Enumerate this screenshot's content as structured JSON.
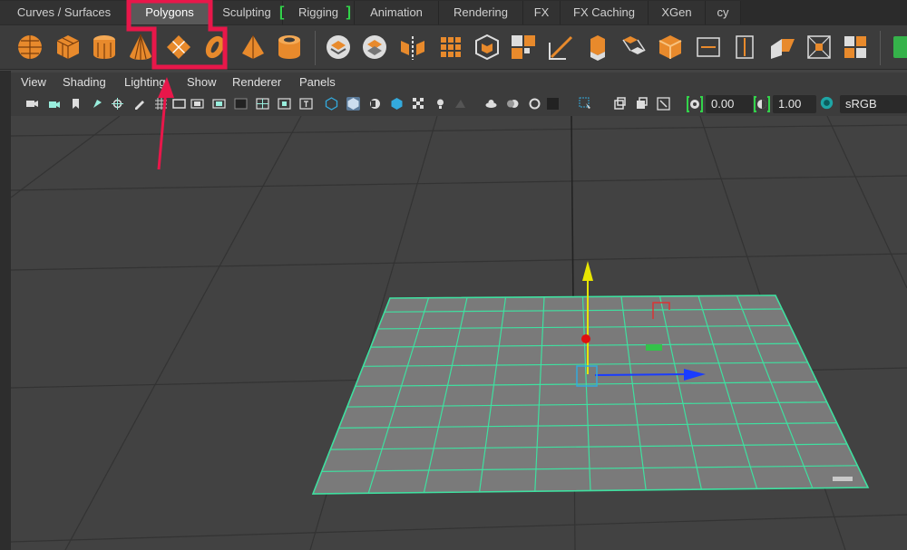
{
  "shelf_tabs": [
    {
      "label": "Curves / Surfaces"
    },
    {
      "label": "Polygons",
      "active": true
    },
    {
      "label": "Sculpting"
    },
    {
      "label": "Rigging"
    },
    {
      "label": "Animation"
    },
    {
      "label": "Rendering"
    },
    {
      "label": "FX"
    },
    {
      "label": "FX Caching"
    },
    {
      "label": "XGen"
    },
    {
      "label": "cy"
    }
  ],
  "shelf_icons": [
    {
      "name": "poly-sphere-icon"
    },
    {
      "name": "poly-cube-icon"
    },
    {
      "name": "poly-cylinder-icon"
    },
    {
      "name": "poly-cone-icon"
    },
    {
      "name": "poly-plane-icon"
    },
    {
      "name": "poly-torus-icon"
    },
    {
      "name": "poly-pyramid-icon"
    },
    {
      "name": "poly-pipe-icon"
    },
    {
      "name": "combine-icon"
    },
    {
      "name": "separate-icon"
    },
    {
      "name": "mirror-icon"
    },
    {
      "name": "smooth-icon"
    },
    {
      "name": "boolean-icon"
    },
    {
      "name": "reduce-icon"
    },
    {
      "name": "multi-cut-icon"
    },
    {
      "name": "extrude-icon"
    },
    {
      "name": "bridge-icon"
    },
    {
      "name": "bevel-icon"
    },
    {
      "name": "uv-planar-icon"
    },
    {
      "name": "uv-cylindrical-icon"
    },
    {
      "name": "uv-editor-icon"
    },
    {
      "name": "uv-automatic-icon"
    },
    {
      "name": "texture-icon"
    },
    {
      "name": "render-icon"
    }
  ],
  "panel_menu": [
    "View",
    "Shading",
    "Lighting",
    "Show",
    "Renderer",
    "Panels"
  ],
  "viewport_toolbar": {
    "exposure_value": "0.00",
    "gamma_value": "1.00",
    "color_space": "sRGB gamm"
  },
  "colors": {
    "accent_red": "#e8174a",
    "wireframe_green": "#3fe0a0",
    "shelf_icon_orange": "#e88a2c",
    "manip_y": "#e8e500",
    "manip_x": "#1a3cff"
  }
}
